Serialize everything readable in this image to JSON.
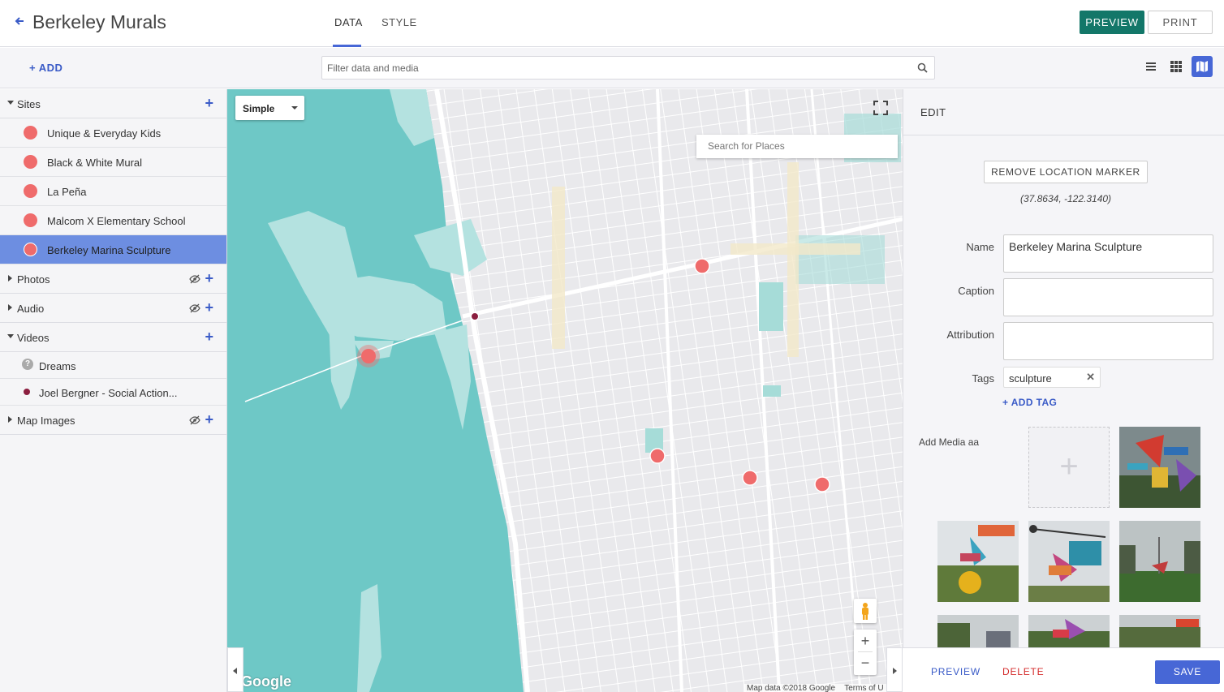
{
  "header": {
    "title": "Berkeley Murals",
    "tabs": [
      "DATA",
      "STYLE"
    ],
    "active_tab": "DATA",
    "preview_label": "PREVIEW",
    "print_label": "PRINT"
  },
  "toolbar": {
    "add_label": "+ ADD",
    "filter_placeholder": "Filter data and media",
    "view_modes": [
      "list-view-icon",
      "grid-view-icon",
      "map-view-icon"
    ],
    "active_view": "map-view-icon"
  },
  "sidebar": {
    "groups": [
      {
        "label": "Sites",
        "expanded": true,
        "items": [
          "Unique & Everyday Kids",
          "Black & White Mural",
          "La Peña",
          "Malcom X Elementary School",
          "Berkeley Marina Sculpture"
        ],
        "selected": "Berkeley Marina Sculpture"
      },
      {
        "label": "Photos",
        "expanded": false
      },
      {
        "label": "Audio",
        "expanded": false
      },
      {
        "label": "Videos",
        "expanded": true,
        "items": [
          "Dreams",
          "Joel Bergner - Social Action..."
        ]
      },
      {
        "label": "Map Images",
        "expanded": false
      }
    ]
  },
  "map": {
    "style_select": "Simple",
    "place_search_placeholder": "Search for Places",
    "logo": "Google",
    "attribution": "Map data ©2018 Google",
    "terms": "Terms of U",
    "zoom_in": "+",
    "zoom_out": "−"
  },
  "edit": {
    "header": "EDIT",
    "remove_marker_label": "REMOVE LOCATION MARKER",
    "coordinates": "(37.8634, -122.3140)",
    "fields": {
      "name_label": "Name",
      "name_value": "Berkeley Marina Sculpture",
      "caption_label": "Caption",
      "caption_value": "",
      "attribution_label": "Attribution",
      "attribution_value": "",
      "tags_label": "Tags",
      "tags": [
        "sculpture"
      ]
    },
    "add_tag_label": "ADD TAG",
    "add_media_label": "Add Media aa",
    "add_media_icon": "+",
    "footer": {
      "preview_label": "PREVIEW",
      "delete_label": "DELETE",
      "save_label": "SAVE"
    }
  },
  "colors": {
    "accent": "#4767d6",
    "preview_button": "#137769",
    "marker": "#ef6b6b",
    "water": "#6ec8c6",
    "delete": "#d42b2b"
  }
}
